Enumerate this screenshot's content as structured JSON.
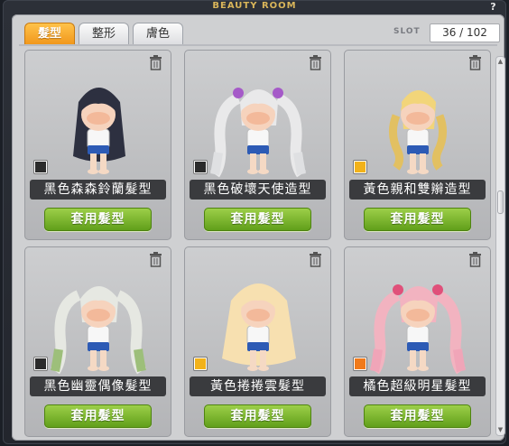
{
  "window": {
    "title": "BEAUTY ROOM",
    "help_label": "?"
  },
  "tabs": [
    {
      "label": "髮型",
      "active": true
    },
    {
      "label": "整形",
      "active": false
    },
    {
      "label": "膚色",
      "active": false
    }
  ],
  "slot": {
    "label": "SLOT",
    "value": "36 / 102"
  },
  "apply_label": "套用髮型",
  "cards": [
    {
      "name": "黑色森森鈴蘭髮型",
      "swatch_color": "#2b2b2b",
      "hair_color": "#2d3040",
      "hair_style": "long-dark"
    },
    {
      "name": "黑色破壞天使造型",
      "swatch_color": "#2b2b2b",
      "hair_color": "#e9e9ea",
      "hair_style": "twin-silver"
    },
    {
      "name": "黃色親和雙辮造型",
      "swatch_color": "#f2b21a",
      "hair_color": "#f2d57a",
      "hair_style": "braids-blonde"
    },
    {
      "name": "黑色幽靈偶像髮型",
      "swatch_color": "#2b2b2b",
      "hair_color": "#e6e8e2",
      "hair_style": "twin-ombre"
    },
    {
      "name": "黃色捲捲雲髮型",
      "swatch_color": "#f2b21a",
      "hair_color": "#f7e0b0",
      "hair_style": "curly-blonde"
    },
    {
      "name": "橘色超級明星髮型",
      "swatch_color": "#f07a1a",
      "hair_color": "#f2b3c0",
      "hair_style": "twin-pink"
    }
  ]
}
